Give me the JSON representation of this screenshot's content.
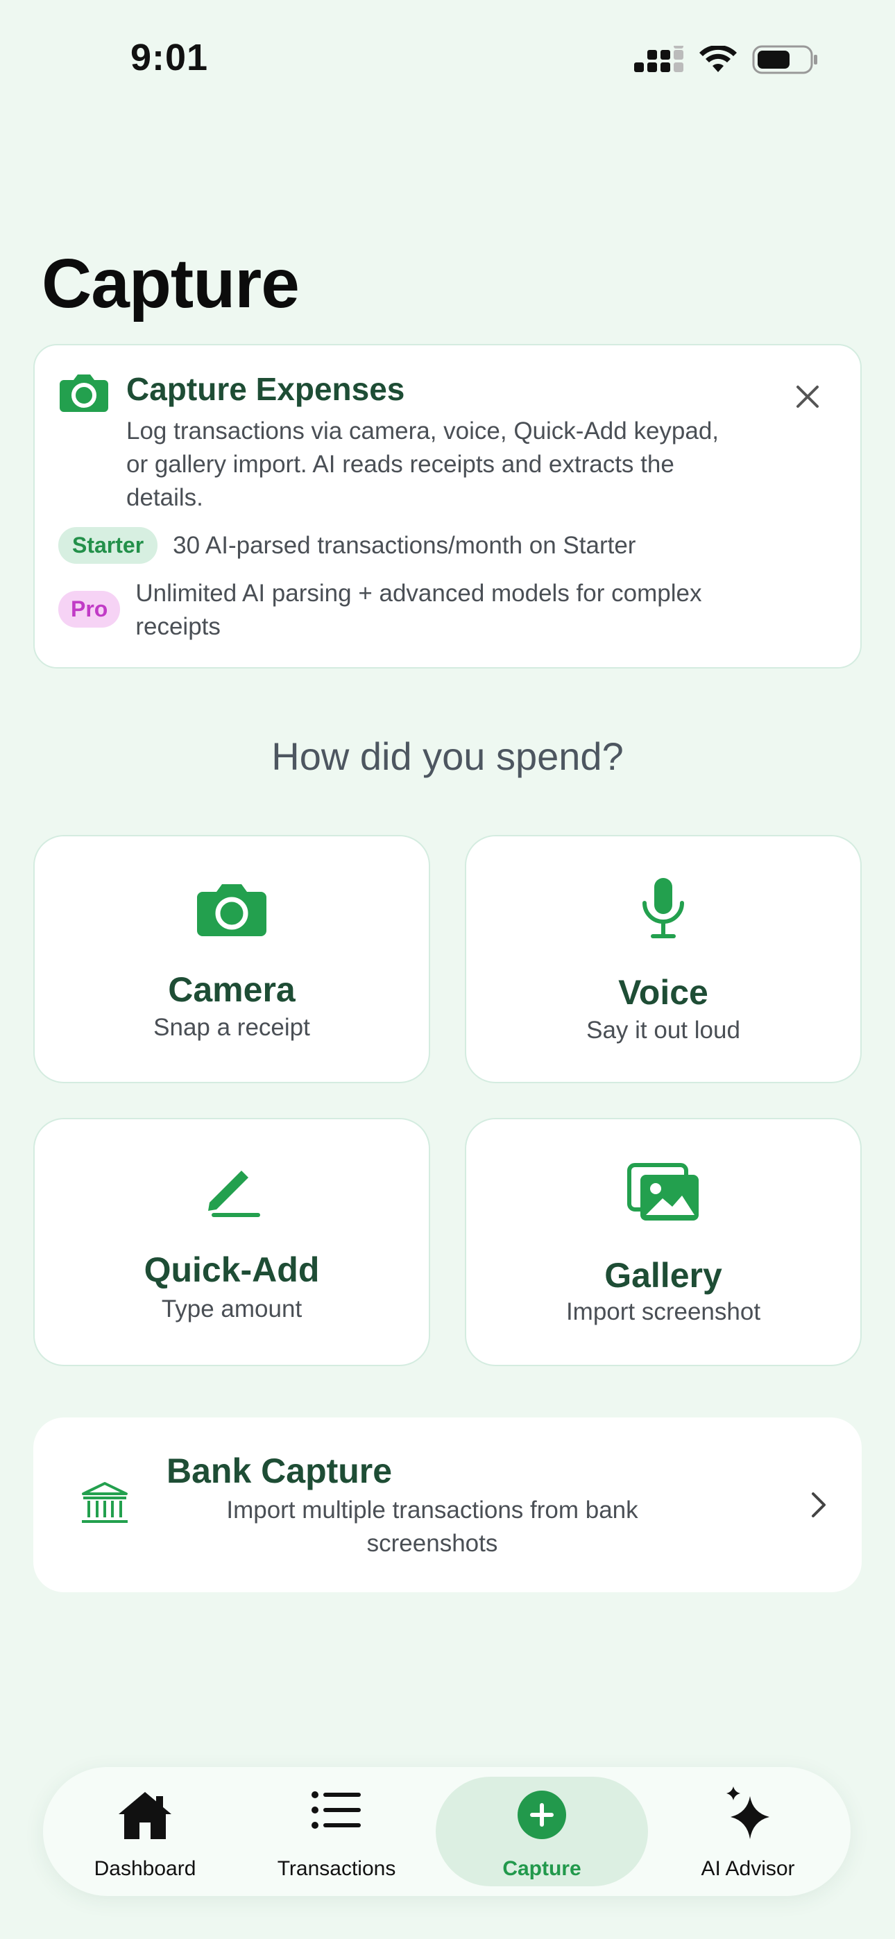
{
  "status_bar": {
    "time": "9:01"
  },
  "page": {
    "title": "Capture"
  },
  "info_card": {
    "title": "Capture Expenses",
    "description": "Log transactions via camera, voice, Quick-Add keypad, or gallery import. AI reads receipts and extracts the details.",
    "tiers": [
      {
        "badge": "Starter",
        "text": "30 AI-parsed transactions/month on Starter"
      },
      {
        "badge": "Pro",
        "text": "Unlimited AI parsing + advanced models for complex receipts"
      }
    ]
  },
  "prompt": "How did you spend?",
  "options": [
    {
      "label": "Camera",
      "sub": "Snap a receipt",
      "icon": "camera-icon"
    },
    {
      "label": "Voice",
      "sub": "Say it out loud",
      "icon": "microphone-icon"
    },
    {
      "label": "Quick-Add",
      "sub": "Type amount",
      "icon": "pencil-icon"
    },
    {
      "label": "Gallery",
      "sub": "Import screenshot",
      "icon": "photos-icon"
    }
  ],
  "bank_capture": {
    "title": "Bank Capture",
    "description": "Import multiple transactions from bank screenshots",
    "icon": "bank-icon"
  },
  "tab_bar": {
    "active": "Capture",
    "tabs": [
      {
        "label": "Dashboard",
        "icon": "house-icon"
      },
      {
        "label": "Transactions",
        "icon": "list-icon"
      },
      {
        "label": "Capture",
        "icon": "plus-circle-icon"
      },
      {
        "label": "AI Advisor",
        "icon": "sparkles-icon"
      }
    ]
  },
  "colors": {
    "background": "#eef8f1",
    "accent": "#22994c",
    "heading": "#1e4d35",
    "starter_badge": "#d7efe1",
    "pro_badge": "#f6d3f5"
  }
}
